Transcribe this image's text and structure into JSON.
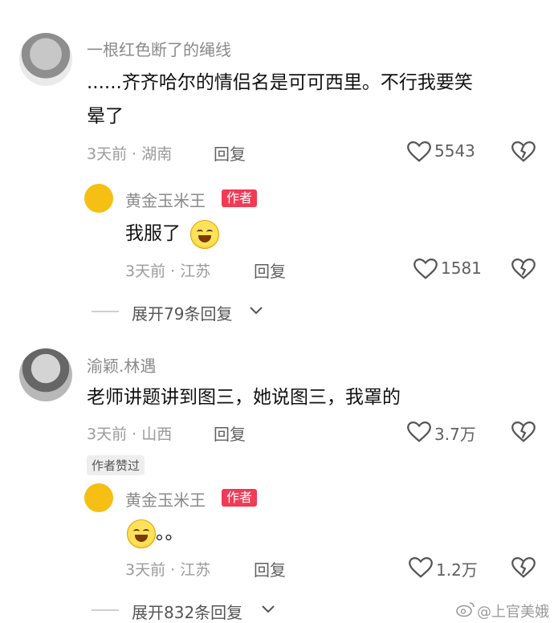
{
  "comments": [
    {
      "username": "一根红色断了的绳线",
      "text_line1": "......齐齐哈尔的情侣名是可可西里。不行我要笑",
      "text_line2": "晕了",
      "meta": "3天前 · 湖南",
      "reply_label": "回复",
      "likes": "5543",
      "reply": {
        "username": "黄金玉米王",
        "badge": "作者",
        "text": "我服了",
        "meta": "3天前 · 江苏",
        "reply_label": "回复",
        "likes": "1581"
      },
      "expand_text": "展开79条回复"
    },
    {
      "username": "渝颖.林遇",
      "text": "老师讲题讲到图三，她说图三，我罩的",
      "meta": "3天前 · 山西",
      "reply_label": "回复",
      "likes": "3.7万",
      "liked_badge": "作者赞过",
      "reply": {
        "username": "黄金玉米王",
        "badge": "作者",
        "text": "。。",
        "meta": "3天前 · 江苏",
        "reply_label": "回复",
        "likes": "1.2万"
      },
      "expand_text": "展开832条回复"
    }
  ],
  "watermark": "@上官美娥",
  "colors": {
    "author_badge": "#f23a55",
    "gold_avatar": "#f5bf14"
  },
  "icons": [
    "heart-icon",
    "broken-heart-icon",
    "chevron-down-icon",
    "weibo-icon",
    "grin-emoji-icon"
  ]
}
